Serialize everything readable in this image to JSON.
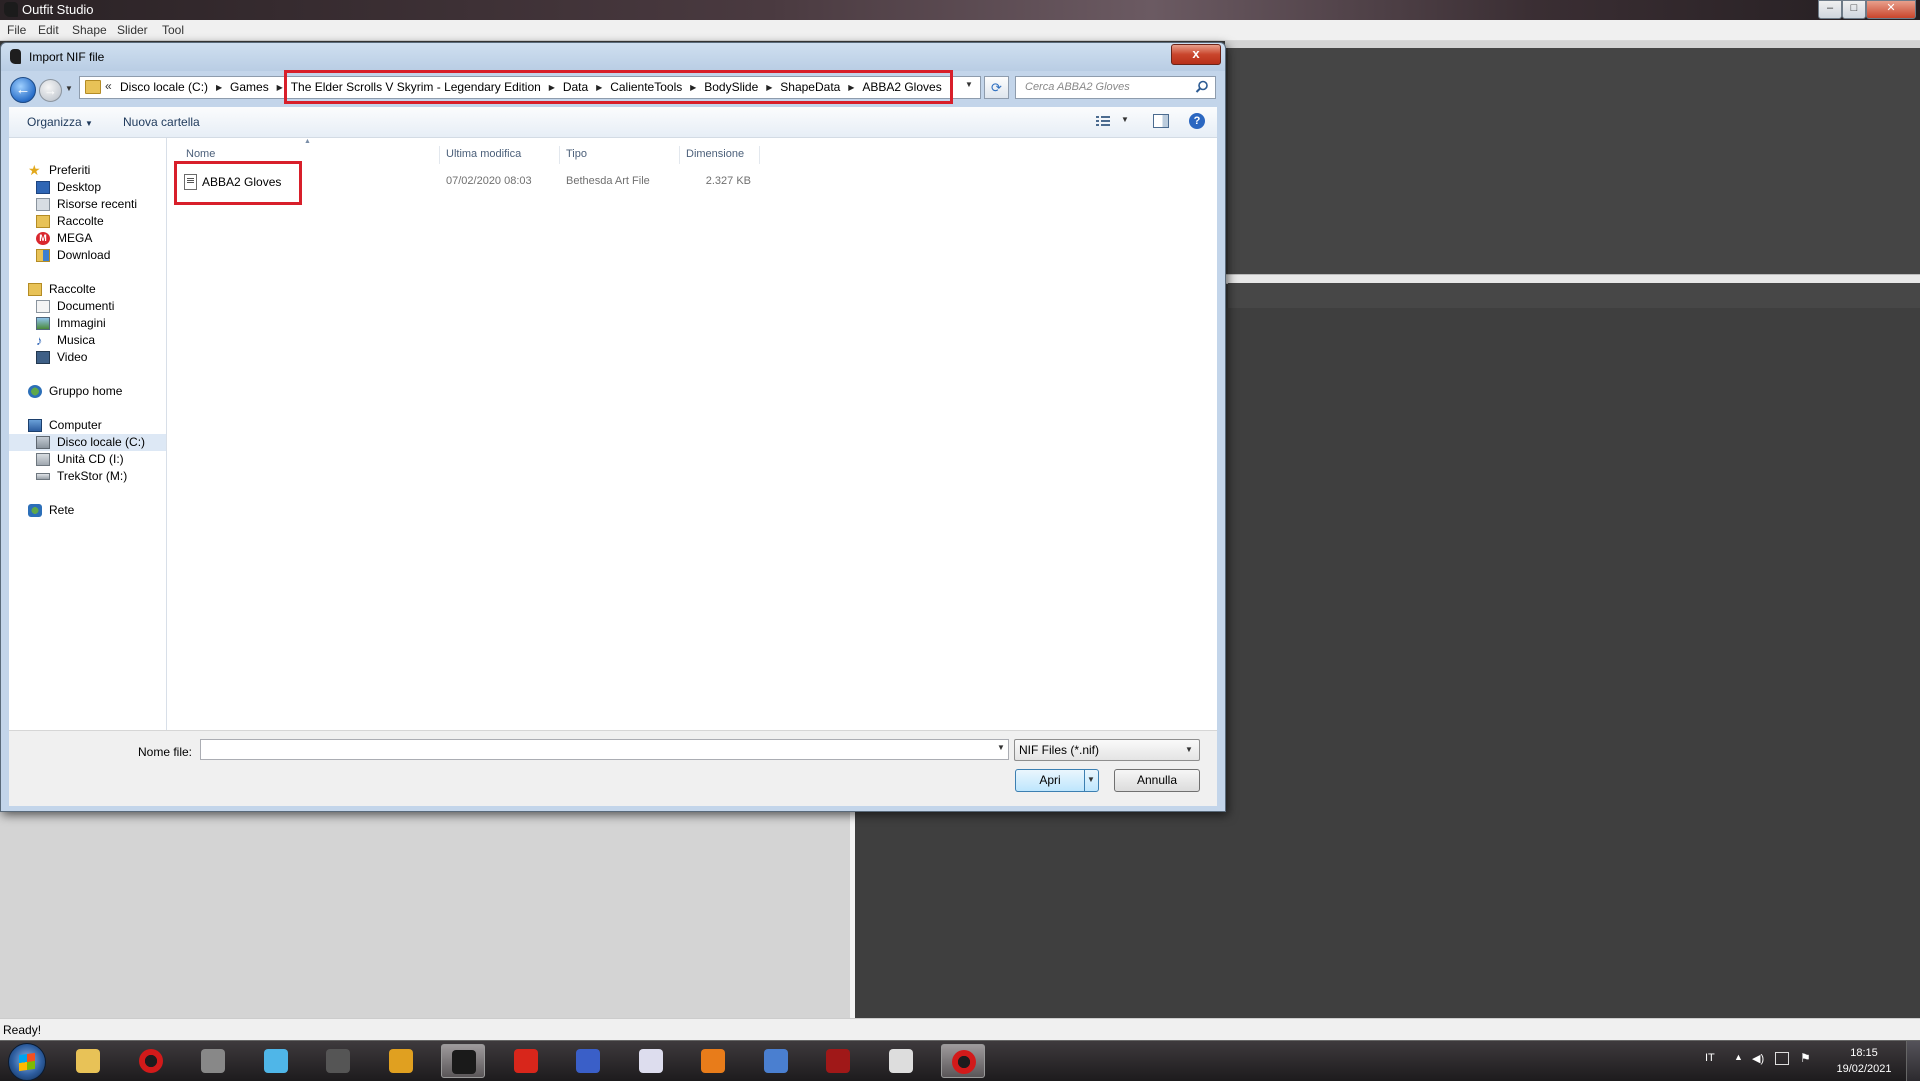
{
  "app": {
    "title": "Outfit Studio",
    "menu": [
      "File",
      "Edit",
      "Shape",
      "Slider",
      "Tool"
    ],
    "status": "Ready!"
  },
  "dialog": {
    "title": "Import NIF file",
    "close_glyph": "x",
    "address": {
      "chevron": "«",
      "crumbs": [
        "Disco locale (C:)",
        "Games",
        "The Elder Scrolls V Skyrim - Legendary Edition",
        "Data",
        "CalienteTools",
        "BodySlide",
        "ShapeData",
        "ABBA2 Gloves"
      ]
    },
    "search_placeholder": "Cerca ABBA2 Gloves",
    "toolbar": {
      "organize": "Organizza",
      "new_folder": "Nuova cartella"
    },
    "nav": {
      "favorites": {
        "label": "Preferiti",
        "items": [
          "Desktop",
          "Risorse recenti",
          "Raccolte",
          "MEGA",
          "Download"
        ]
      },
      "libraries": {
        "label": "Raccolte",
        "items": [
          "Documenti",
          "Immagini",
          "Musica",
          "Video"
        ]
      },
      "homegroup": "Gruppo home",
      "computer": {
        "label": "Computer",
        "items": [
          "Disco locale (C:)",
          "Unità CD (I:)",
          "TrekStor (M:)"
        ]
      },
      "network": "Rete"
    },
    "columns": [
      "Nome",
      "Ultima modifica",
      "Tipo",
      "Dimensione"
    ],
    "files": [
      {
        "name": "ABBA2 Gloves",
        "modified": "07/02/2020 08:03",
        "type": "Bethesda Art File",
        "size": "2.327 KB"
      }
    ],
    "filename_label": "Nome file:",
    "filename_value": "",
    "filter": "NIF Files (*.nif)",
    "open_label": "Apri",
    "cancel_label": "Annulla"
  },
  "taskbar": {
    "apps": [
      "explorer-icon",
      "opera-icon",
      "media-player-icon",
      "itunes-icon",
      "winamp-icon",
      "folder-app-icon",
      "outfit-studio-icon",
      "foxit-icon",
      "ffdec-icon",
      "window-app-icon",
      "xfire-icon",
      "quill-icon",
      "spider-icon",
      "people-icon",
      "opera-active-icon"
    ],
    "lang": "IT",
    "time": "18:15",
    "date": "19/02/2021"
  },
  "colors": {
    "highlight": "#d81f2a",
    "dialog_frame": "#c3d5ea",
    "viewport": "#3f3f3f"
  }
}
